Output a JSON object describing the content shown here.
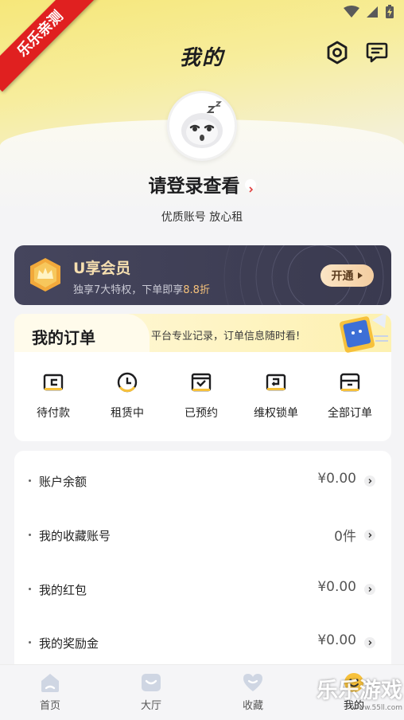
{
  "watermark": {
    "top_left": "乐乐亲测",
    "bottom_right": "乐乐游戏",
    "url": "www.55ll.com"
  },
  "header": {
    "title": "我的",
    "settings_icon": "settings-icon",
    "message_icon": "message-icon"
  },
  "profile": {
    "title": "请登录查看",
    "subtitle": "优质账号 放心租"
  },
  "vip": {
    "title": "U享会员",
    "desc_prefix": "独享7大特权，下单即享",
    "desc_highlight": "8.8折",
    "button": "开通",
    "colors": {
      "bg": "#3f3f55",
      "gold": "#f6dfb0",
      "highlight": "#f6c27b"
    }
  },
  "orders": {
    "title": "我的订单",
    "tip": "平台专业记录，订单信息随时看!",
    "items": [
      {
        "label": "待付款",
        "icon": "wallet-icon"
      },
      {
        "label": "租赁中",
        "icon": "clock-icon"
      },
      {
        "label": "已预约",
        "icon": "calendar-check-icon"
      },
      {
        "label": "维权锁单",
        "icon": "lock-order-icon"
      },
      {
        "label": "全部订单",
        "icon": "box-icon"
      }
    ]
  },
  "account_list": [
    {
      "label": "账户余额",
      "value": "¥0.00"
    },
    {
      "label": "我的收藏账号",
      "value": "0件"
    },
    {
      "label": "我的红包",
      "value": "¥0.00"
    },
    {
      "label": "我的奖励金",
      "value": "¥0.00"
    }
  ],
  "tabbar": [
    {
      "label": "首页",
      "icon": "home-icon"
    },
    {
      "label": "大厅",
      "icon": "hall-icon"
    },
    {
      "label": "收藏",
      "icon": "heart-icon"
    },
    {
      "label": "我的",
      "icon": "profile-smile-icon",
      "active": true
    }
  ]
}
